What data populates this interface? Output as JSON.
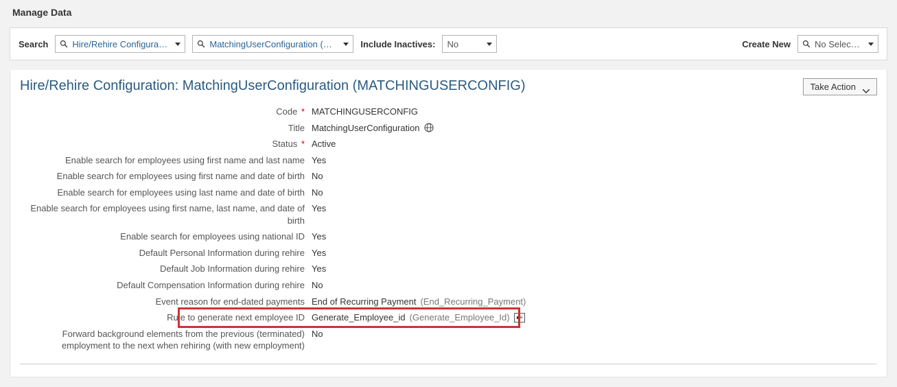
{
  "page_title": "Manage Data",
  "toolbar": {
    "search_label": "Search",
    "combo1_value": "Hire/Rehire Configuration",
    "combo2_value": "MatchingUserConfiguration (MAT...",
    "include_inactives_label": "Include Inactives:",
    "include_inactives_value": "No",
    "create_new_label": "Create New",
    "create_new_value": "No Selection"
  },
  "object_title": "Hire/Rehire Configuration: MatchingUserConfiguration (MATCHINGUSERCONFIG)",
  "take_action_label": "Take Action",
  "fields": {
    "code": {
      "label": "Code",
      "value": "MATCHINGUSERCONFIG",
      "required": true
    },
    "title": {
      "label": "Title",
      "value": "MatchingUserConfiguration",
      "required": false
    },
    "status": {
      "label": "Status",
      "value": "Active",
      "required": true
    },
    "search_fn_ln": {
      "label": "Enable search for employees using first name and last name",
      "value": "Yes"
    },
    "search_fn_dob": {
      "label": "Enable search for employees using first name and date of birth",
      "value": "No"
    },
    "search_ln_dob": {
      "label": "Enable search for employees using last name and date of birth",
      "value": "No"
    },
    "search_fn_ln_dob": {
      "label": "Enable search for employees using first name, last name, and date of birth",
      "value": "Yes"
    },
    "search_nid": {
      "label": "Enable search for employees using national ID",
      "value": "Yes"
    },
    "default_personal": {
      "label": "Default Personal Information during rehire",
      "value": "Yes"
    },
    "default_job": {
      "label": "Default Job Information during rehire",
      "value": "Yes"
    },
    "default_comp": {
      "label": "Default Compensation Information during rehire",
      "value": "No"
    },
    "event_reason": {
      "label": "Event reason for end-dated payments",
      "value": "End of Recurring Payment",
      "paren": "(End_Recurring_Payment)"
    },
    "rule": {
      "label": "Rule to generate next employee ID",
      "value": "Generate_Employee_id",
      "paren": "(Generate_Employee_Id)"
    },
    "forward_bg": {
      "label": "Forward background elements from the previous (terminated) employment to the next when rehiring (with new employment)",
      "value": "No"
    }
  }
}
